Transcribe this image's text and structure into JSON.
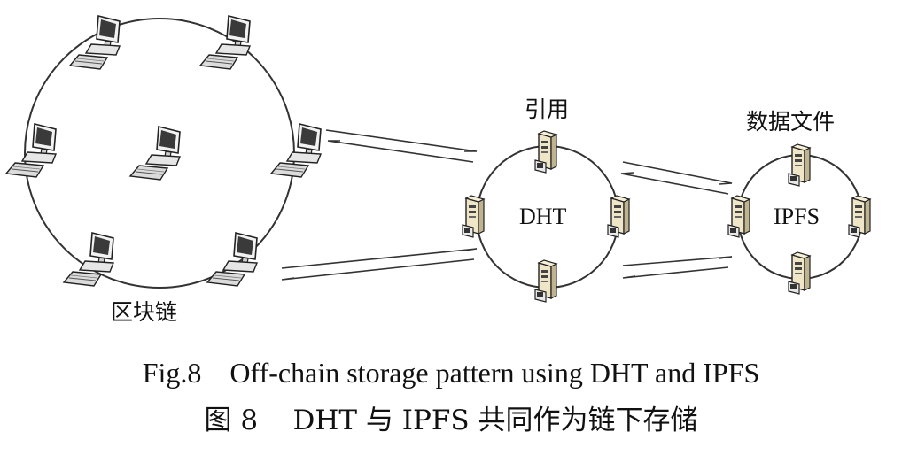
{
  "diagram": {
    "blockchain_label": "区块链",
    "reference_label": "引用",
    "datafile_label": "数据文件",
    "dht_label": "DHT",
    "ipfs_label": "IPFS"
  },
  "caption": {
    "english": "Fig.8    Off-chain storage pattern using DHT and IPFS",
    "chinese": "图 8    DHT 与 IPFS 共同作为链下存储"
  },
  "icons": {
    "computer": "desktop-computer-icon",
    "server": "tower-server-icon"
  }
}
